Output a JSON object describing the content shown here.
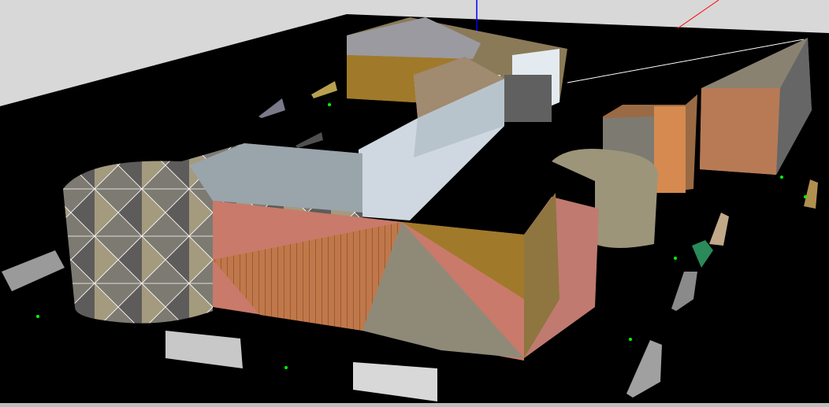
{
  "viewport": {
    "type": "3d-level-editor-viewport",
    "colors": {
      "sky": "#d8d8d8",
      "floor": "#000000",
      "wall_light": "#c9d3dc",
      "wall_gray": "#8a8a8a",
      "brick": "#c97a6a",
      "wood": "#b06a40",
      "gold": "#a07a2a",
      "stone": "#8f8a78",
      "axis_y": "#0000ff",
      "axis_x": "#ff0000",
      "marker": "#00ff00"
    },
    "barrier_count": 11,
    "marker_count": 7
  }
}
